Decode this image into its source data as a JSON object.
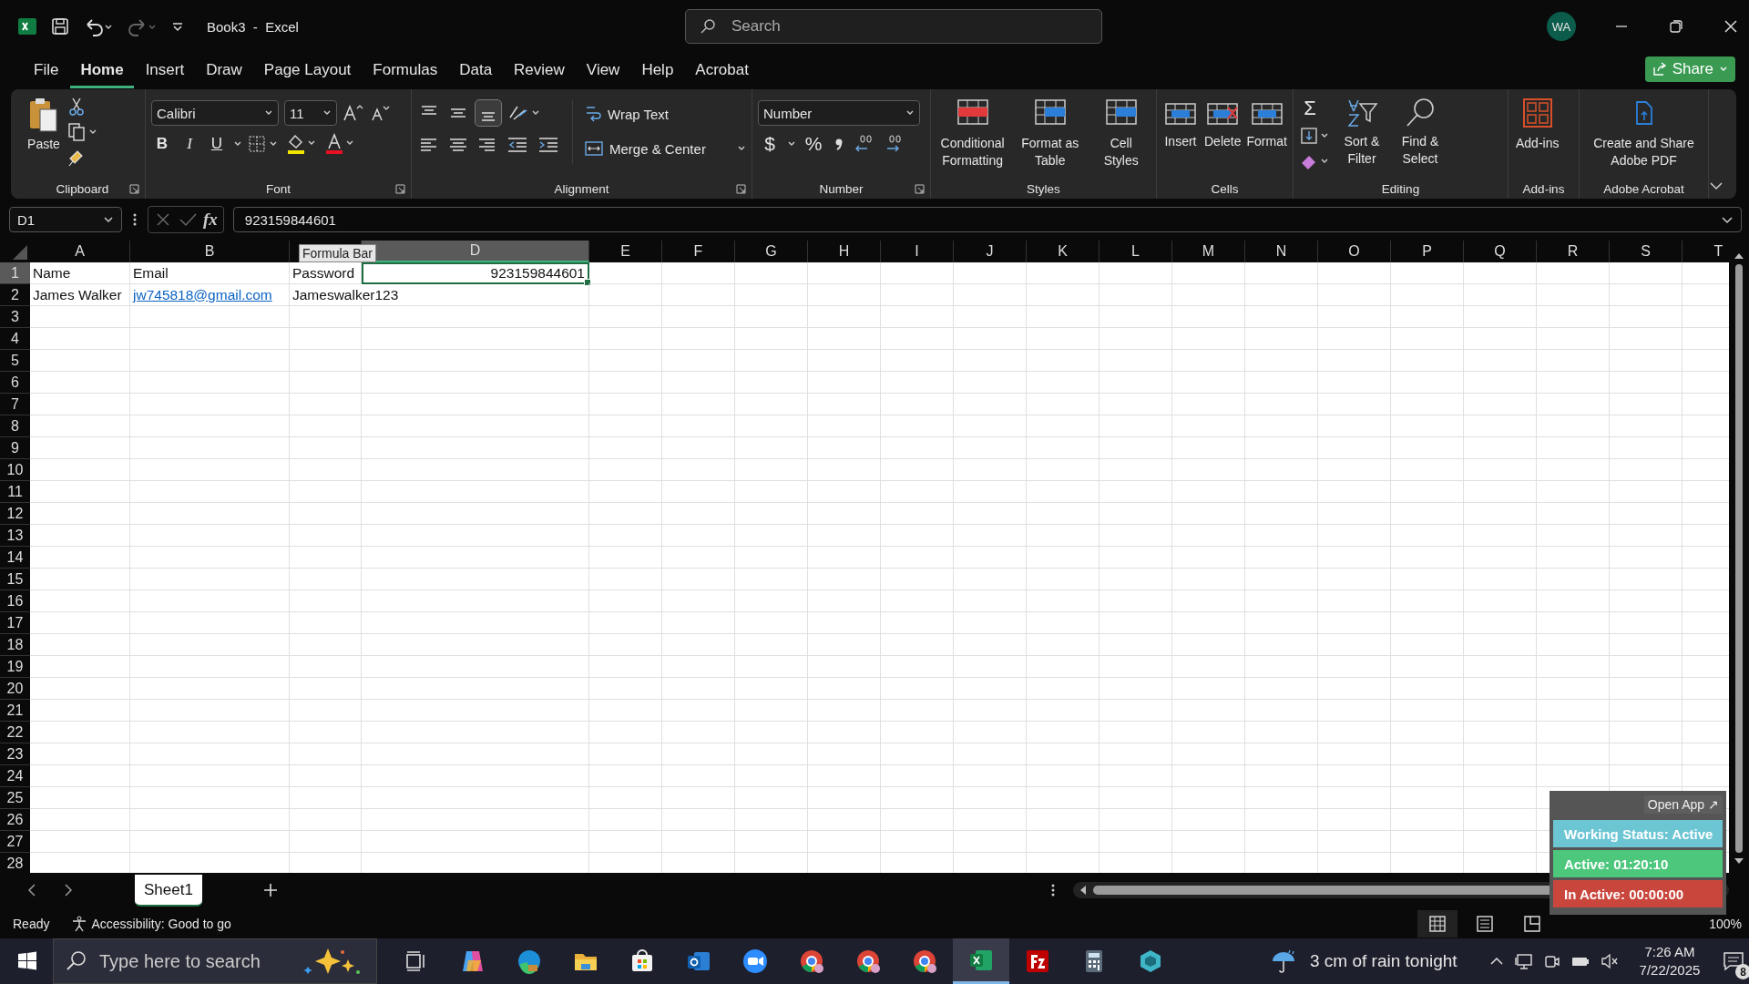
{
  "window": {
    "title": "Book3  -  Excel",
    "search_placeholder": "Search",
    "avatar": "WA"
  },
  "menu_tabs": [
    {
      "label": "File",
      "selected": false
    },
    {
      "label": "Home",
      "selected": true
    },
    {
      "label": "Insert",
      "selected": false
    },
    {
      "label": "Draw",
      "selected": false
    },
    {
      "label": "Page Layout",
      "selected": false
    },
    {
      "label": "Formulas",
      "selected": false
    },
    {
      "label": "Data",
      "selected": false
    },
    {
      "label": "Review",
      "selected": false
    },
    {
      "label": "View",
      "selected": false
    },
    {
      "label": "Help",
      "selected": false
    },
    {
      "label": "Acrobat",
      "selected": false
    }
  ],
  "share_button": "Share",
  "ribbon": {
    "clipboard": {
      "label": "Clipboard",
      "paste": "Paste"
    },
    "font": {
      "label": "Font",
      "font_name": "Calibri",
      "font_size": "11",
      "bold": "B",
      "italic": "I",
      "underline": "U"
    },
    "alignment": {
      "label": "Alignment",
      "wrap_text": "Wrap Text",
      "merge": "Merge & Center",
      "bottom_align_selected": true
    },
    "number": {
      "label": "Number",
      "format": "Number",
      "currency": "$",
      "percent": "%"
    },
    "styles": {
      "label": "Styles",
      "buttons": [
        "Conditional Formatting",
        "Format as Table",
        "Cell Styles"
      ]
    },
    "cells": {
      "label": "Cells",
      "buttons": [
        "Insert",
        "Delete",
        "Format"
      ]
    },
    "editing": {
      "label": "Editing",
      "sum": "Σ",
      "buttons": [
        "Sort & Filter",
        "Find & Select"
      ]
    },
    "addins": {
      "label": "Add-ins",
      "button": "Add-ins"
    },
    "acrobat": {
      "label": "Adobe Acrobat",
      "button": "Create and Share Adobe PDF"
    }
  },
  "formula_bar": {
    "name_box": "D1",
    "function_button": "fx",
    "value": "923159844601",
    "tooltip": "Formula Bar"
  },
  "columns": [
    {
      "letter": "A",
      "selected": false
    },
    {
      "letter": "B",
      "selected": false
    },
    {
      "selected": false
    },
    {
      "letter": "D",
      "selected": true
    },
    {
      "letter": "E",
      "selected": false
    },
    {
      "letter": "F",
      "selected": false
    },
    {
      "letter": "G",
      "selected": false
    },
    {
      "letter": "H",
      "selected": false
    },
    {
      "letter": "I",
      "selected": false
    },
    {
      "letter": "J",
      "selected": false
    },
    {
      "letter": "K",
      "selected": false
    },
    {
      "letter": "L",
      "selected": false
    },
    {
      "letter": "M",
      "selected": false
    },
    {
      "letter": "N",
      "selected": false
    },
    {
      "letter": "O",
      "selected": false
    },
    {
      "letter": "P",
      "selected": false
    },
    {
      "letter": "Q",
      "selected": false
    },
    {
      "letter": "R",
      "selected": false
    },
    {
      "letter": "S",
      "selected": false
    },
    {
      "letter": "T",
      "selected": false
    }
  ],
  "rows": [
    {
      "number": "1",
      "selected": true,
      "cells": [
        {
          "text": "Name",
          "kind": "text",
          "active": false
        },
        {
          "text": "Email",
          "kind": "text",
          "active": false
        },
        {
          "text": "Password",
          "kind": "text",
          "active": false
        },
        {
          "text": "923159844601",
          "kind": "number",
          "active": true
        }
      ]
    },
    {
      "number": "2",
      "selected": false,
      "cells": [
        {
          "text": "James Walker",
          "kind": "text",
          "active": false
        },
        {
          "text": "jw745818@gmail.com",
          "kind": "link",
          "active": false
        },
        {
          "text": "Jameswalker123",
          "kind": "text",
          "active": false
        }
      ]
    },
    {
      "number": "3",
      "selected": false
    },
    {
      "number": "4",
      "selected": false
    },
    {
      "number": "5",
      "selected": false
    },
    {
      "number": "6",
      "selected": false
    },
    {
      "number": "7",
      "selected": false
    },
    {
      "number": "8",
      "selected": false
    },
    {
      "number": "9",
      "selected": false
    },
    {
      "number": "10",
      "selected": false
    },
    {
      "number": "11",
      "selected": false
    },
    {
      "number": "12",
      "selected": false
    },
    {
      "number": "13",
      "selected": false
    },
    {
      "number": "14",
      "selected": false
    },
    {
      "number": "15",
      "selected": false
    },
    {
      "number": "16",
      "selected": false
    },
    {
      "number": "17",
      "selected": false
    },
    {
      "number": "18",
      "selected": false
    },
    {
      "number": "19",
      "selected": false
    },
    {
      "number": "20",
      "selected": false
    },
    {
      "number": "21",
      "selected": false
    },
    {
      "number": "22",
      "selected": false
    },
    {
      "number": "23",
      "selected": false
    },
    {
      "number": "24",
      "selected": false
    },
    {
      "number": "25",
      "selected": false
    },
    {
      "number": "26",
      "selected": false
    },
    {
      "number": "27",
      "selected": false
    },
    {
      "number": "28",
      "selected": false
    }
  ],
  "sheet_tabs": [
    {
      "label": "Sheet1",
      "selected": true
    }
  ],
  "status_bar": {
    "mode": "Ready",
    "accessibility": "Accessibility: Good to go",
    "zoom": "100%"
  },
  "tracker_widget": {
    "open_app": "Open App ↗",
    "statuses": [
      {
        "label": "Working Status: Active",
        "color": "#6cc5d3"
      },
      {
        "label": "Active: 01:20:10",
        "color": "#4cc77c"
      },
      {
        "label": "In Active: 00:00:00",
        "color": "#c9463d"
      }
    ]
  },
  "taskbar": {
    "search_placeholder": "Type here to search",
    "weather": "3 cm of rain tonight",
    "time": "7:26 AM",
    "date": "7/22/2025",
    "notifications": "8",
    "apps": [
      {
        "kind": "taskview",
        "active": false
      },
      {
        "kind": "copilot",
        "active": false
      },
      {
        "kind": "edge",
        "active": false
      },
      {
        "kind": "folder",
        "active": false
      },
      {
        "kind": "store",
        "active": false
      },
      {
        "kind": "outlook",
        "active": false
      },
      {
        "kind": "zoom",
        "active": false
      },
      {
        "kind": "chrome",
        "active": false
      },
      {
        "kind": "chrome",
        "active": false
      },
      {
        "kind": "chrome",
        "active": false
      },
      {
        "kind": "excel",
        "active": true
      },
      {
        "kind": "filezilla",
        "active": false
      },
      {
        "kind": "calculator",
        "active": false
      },
      {
        "kind": "hexagon",
        "active": false
      }
    ]
  }
}
